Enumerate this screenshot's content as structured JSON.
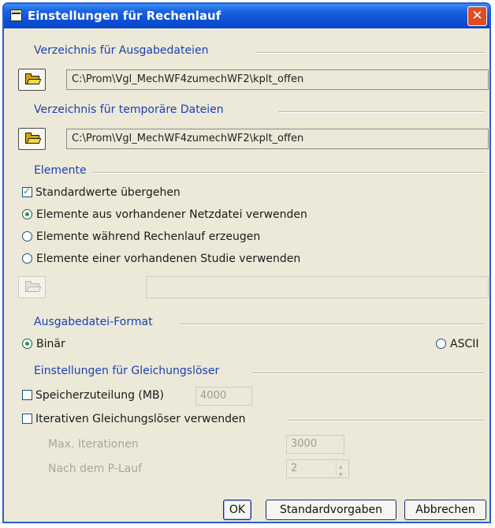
{
  "window": {
    "title": "Einstellungen für Rechenlauf",
    "close_label": "✕"
  },
  "output_dir": {
    "heading": "Verzeichnis für Ausgabedateien",
    "path": "C:\\Prom\\Vgl_MechWF4zumechWF2\\kplt_offen"
  },
  "temp_dir": {
    "heading": "Verzeichnis für temporäre Dateien",
    "path": "C:\\Prom\\Vgl_MechWF4zumechWF2\\kplt_offen"
  },
  "elements": {
    "heading": "Elemente",
    "override_defaults": {
      "label": "Standardwerte übergehen",
      "checked": true
    },
    "options": [
      {
        "label": "Elemente aus vorhandener Netzdatei verwenden",
        "selected": true
      },
      {
        "label": "Elemente während Rechenlauf erzeugen",
        "selected": false
      },
      {
        "label": "Elemente einer vorhandenen Studie verwenden",
        "selected": false
      }
    ],
    "study_path": ""
  },
  "format": {
    "heading": "Ausgabedatei-Format",
    "binary_label": "Binär",
    "binary_selected": true,
    "ascii_label": "ASCII",
    "ascii_selected": false
  },
  "solver": {
    "heading": "Einstellungen für Gleichungslöser",
    "memory_label": "Speicherzuteilung (MB)",
    "memory_checked": false,
    "memory_value": "4000",
    "iterative_label": "Iterativen Gleichungslöser verwenden",
    "iterative_checked": false,
    "max_iter_label": "Max. Iterationen",
    "max_iter_value": "3000",
    "after_p_label": "Nach dem P-Lauf",
    "after_p_value": "2"
  },
  "buttons": {
    "ok": "OK",
    "defaults": "Standardvorgaben",
    "cancel": "Abbrechen"
  },
  "colors": {
    "titlebar": "#0b4fd4",
    "dialog_bg": "#ece9d8",
    "section_heading": "#1a3fb5",
    "check_mark": "#21a121",
    "close": "#e04d25"
  }
}
